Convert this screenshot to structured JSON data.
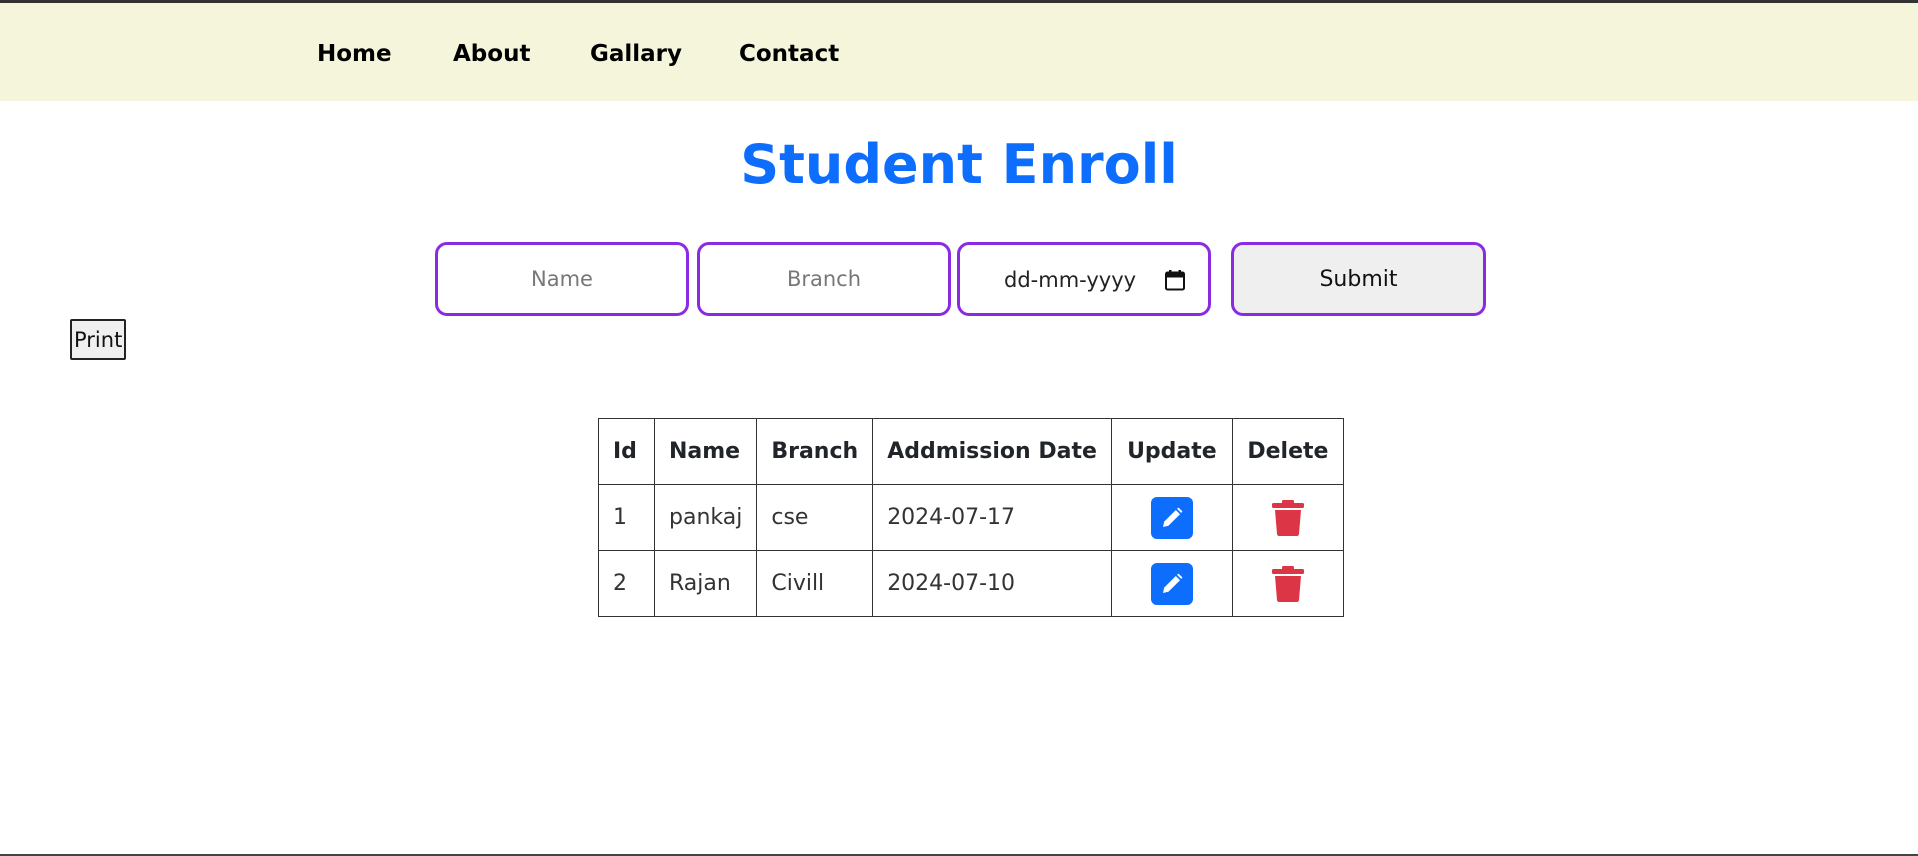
{
  "nav": {
    "items": [
      "Home",
      "About",
      "Gallary",
      "Contact"
    ]
  },
  "page": {
    "title": "Student Enroll"
  },
  "form": {
    "name_placeholder": "Name",
    "branch_placeholder": "Branch",
    "date_placeholder": "dd-mm-yyyy",
    "submit_label": "Submit"
  },
  "print_label": "Print",
  "table": {
    "headers": [
      "Id",
      "Name",
      "Branch",
      "Addmission Date",
      "Update",
      "Delete"
    ],
    "rows": [
      {
        "id": "1",
        "name": "pankaj",
        "branch": "cse",
        "date": "2024-07-17"
      },
      {
        "id": "2",
        "name": "Rajan",
        "branch": "Civill",
        "date": "2024-07-10"
      }
    ]
  },
  "icons": {
    "update": "pencil-icon",
    "delete": "trash-icon",
    "calendar": "calendar-icon"
  },
  "colors": {
    "navbar_bg": "#f5f5dc",
    "title": "#0d6efd",
    "input_border": "#8a2be2",
    "update_button": "#0d6efd",
    "delete_icon": "#dc3545"
  }
}
